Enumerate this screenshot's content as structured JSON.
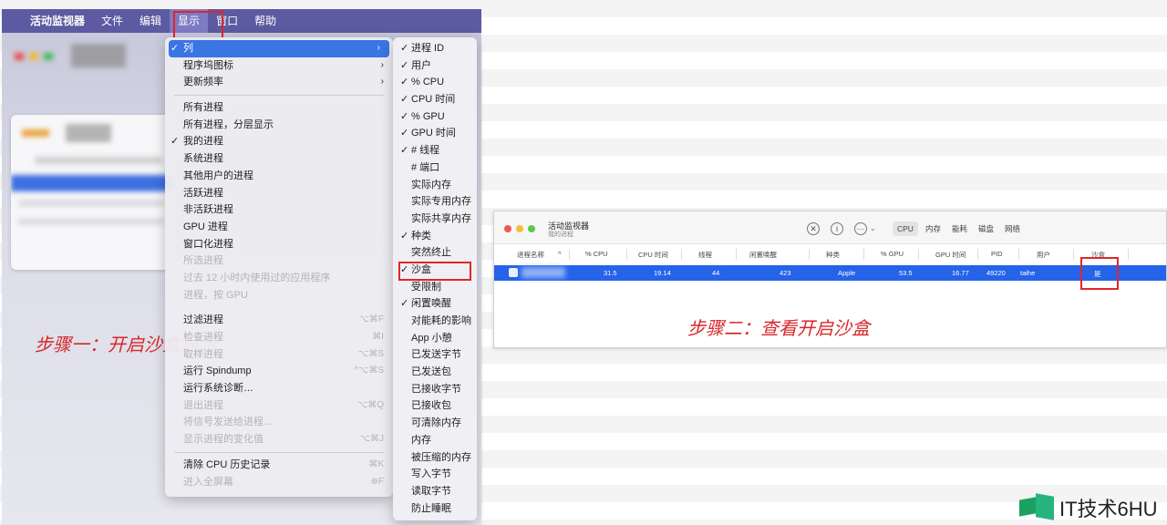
{
  "menubar": {
    "apple_icon": "apple-icon",
    "app_name": "活动监视器",
    "items": [
      "文件",
      "编辑",
      "显示",
      "窗口",
      "帮助"
    ]
  },
  "view_menu": {
    "group1": [
      {
        "label": "列",
        "checked": true,
        "submenu": true,
        "selected": true
      },
      {
        "label": "程序坞图标",
        "submenu": true
      },
      {
        "label": "更新频率",
        "submenu": true
      }
    ],
    "group2": [
      {
        "label": "所有进程"
      },
      {
        "label": "所有进程，分层显示"
      },
      {
        "label": "我的进程",
        "checked": true
      },
      {
        "label": "系统进程"
      },
      {
        "label": "其他用户的进程"
      },
      {
        "label": "活跃进程"
      },
      {
        "label": "非活跃进程"
      },
      {
        "label": "GPU 进程"
      },
      {
        "label": "窗口化进程"
      },
      {
        "label": "所选进程",
        "disabled": true
      },
      {
        "label": "过去 12 小时内使用过的应用程序",
        "disabled": true
      },
      {
        "label": "进程，按 GPU",
        "disabled": true
      }
    ],
    "group3": [
      {
        "label": "过滤进程",
        "shortcut": "⌥⌘F"
      },
      {
        "label": "检查进程",
        "shortcut": "⌘I",
        "disabled": true
      },
      {
        "label": "取样进程",
        "shortcut": "⌥⌘S",
        "disabled": true
      },
      {
        "label": "运行 Spindump",
        "shortcut": "^⌥⌘S"
      },
      {
        "label": "运行系统诊断…"
      },
      {
        "label": "退出进程",
        "shortcut": "⌥⌘Q",
        "disabled": true
      },
      {
        "label": "将信号发送给进程…",
        "disabled": true
      },
      {
        "label": "显示进程的变化值",
        "shortcut": "⌥⌘J",
        "disabled": true
      }
    ],
    "group4": [
      {
        "label": "清除 CPU 历史记录",
        "shortcut": "⌘K"
      },
      {
        "label": "进入全屏幕",
        "shortcut": "⊕F",
        "disabled": true
      }
    ]
  },
  "column_submenu": [
    {
      "label": "进程 ID",
      "checked": true
    },
    {
      "label": "用户",
      "checked": true
    },
    {
      "label": "% CPU",
      "checked": true
    },
    {
      "label": "CPU 时间",
      "checked": true
    },
    {
      "label": "% GPU",
      "checked": true
    },
    {
      "label": "GPU 时间",
      "checked": true
    },
    {
      "label": "# 线程",
      "checked": true
    },
    {
      "label": "# 端口"
    },
    {
      "label": "实际内存"
    },
    {
      "label": "实际专用内存"
    },
    {
      "label": "实际共享内存"
    },
    {
      "label": "种类",
      "checked": true
    },
    {
      "label": "突然终止"
    },
    {
      "label": "沙盒",
      "checked": true
    },
    {
      "label": "受限制"
    },
    {
      "label": "闲置唤醒",
      "checked": true
    },
    {
      "label": "对能耗的影响"
    },
    {
      "label": "App 小憩"
    },
    {
      "label": "已发送字节"
    },
    {
      "label": "已发送包"
    },
    {
      "label": "已接收字节"
    },
    {
      "label": "已接收包"
    },
    {
      "label": "可清除内存"
    },
    {
      "label": "内存"
    },
    {
      "label": "被压缩的内存"
    },
    {
      "label": "写入字节"
    },
    {
      "label": "读取字节"
    },
    {
      "label": "防止睡眠"
    }
  ],
  "step1_label": "步骤一：开启沙盒显示",
  "step2_label": "步骤二：查看开启沙盒",
  "right_window": {
    "title": "活动监视器",
    "subtitle": "我的进程",
    "toolbar_icons": [
      "stop-icon",
      "info-icon",
      "more-icon"
    ],
    "tabs": [
      "CPU",
      "内存",
      "能耗",
      "磁盘",
      "网络"
    ],
    "active_tab": "CPU",
    "columns": [
      "进程名称",
      "% CPU",
      "CPU 时间",
      "线程",
      "闲置唤醒",
      "种类",
      "% GPU",
      "GPU 时间",
      "PID",
      "用户",
      "沙盒"
    ],
    "row": {
      "cpu": "31.5",
      "cpu_time": "19.14",
      "threads": "44",
      "idle_wake": "423",
      "kind": "Apple",
      "gpu": "53.5",
      "gpu_time": "16.77",
      "pid": "49220",
      "user": "taihe",
      "sandbox": "是"
    }
  },
  "watermark": "IT技术6HU"
}
